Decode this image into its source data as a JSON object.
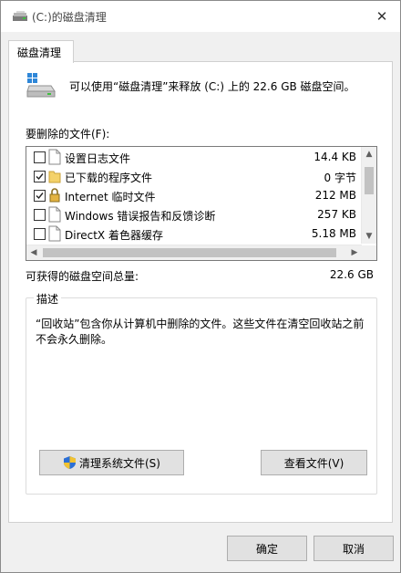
{
  "window": {
    "title": "(C:)的磁盘清理",
    "close_glyph": "✕"
  },
  "tab": {
    "label": "磁盘清理"
  },
  "header": {
    "text": "可以使用“磁盘清理”来释放  (C:) 上的 22.6 GB 磁盘空间。"
  },
  "files_label": "要删除的文件(F):",
  "files": [
    {
      "name": "设置日志文件",
      "size": "14.4 KB",
      "checked": false,
      "icon": "file-icon"
    },
    {
      "name": "已下载的程序文件",
      "size": "0 字节",
      "checked": true,
      "icon": "folder-icon"
    },
    {
      "name": "Internet 临时文件",
      "size": "212 MB",
      "checked": true,
      "icon": "lock-icon"
    },
    {
      "name": "Windows 错误报告和反馈诊断",
      "size": "257 KB",
      "checked": false,
      "icon": "file-icon"
    },
    {
      "name": "DirectX 着色器缓存",
      "size": "5.18 MB",
      "checked": false,
      "icon": "file-icon"
    }
  ],
  "total": {
    "label": "可获得的磁盘空间总量:",
    "value": "22.6 GB"
  },
  "description": {
    "title": "描述",
    "text": "“回收站”包含你从计算机中删除的文件。这些文件在清空回收站之前不会永久删除。"
  },
  "buttons": {
    "clean_system": "清理系统文件(S)",
    "view_files": "查看文件(V)",
    "ok": "确定",
    "cancel": "取消"
  },
  "colors": {
    "folder": "#f4d26a",
    "shield_blue": "#2b6fd6",
    "shield_yellow": "#f2c230"
  }
}
